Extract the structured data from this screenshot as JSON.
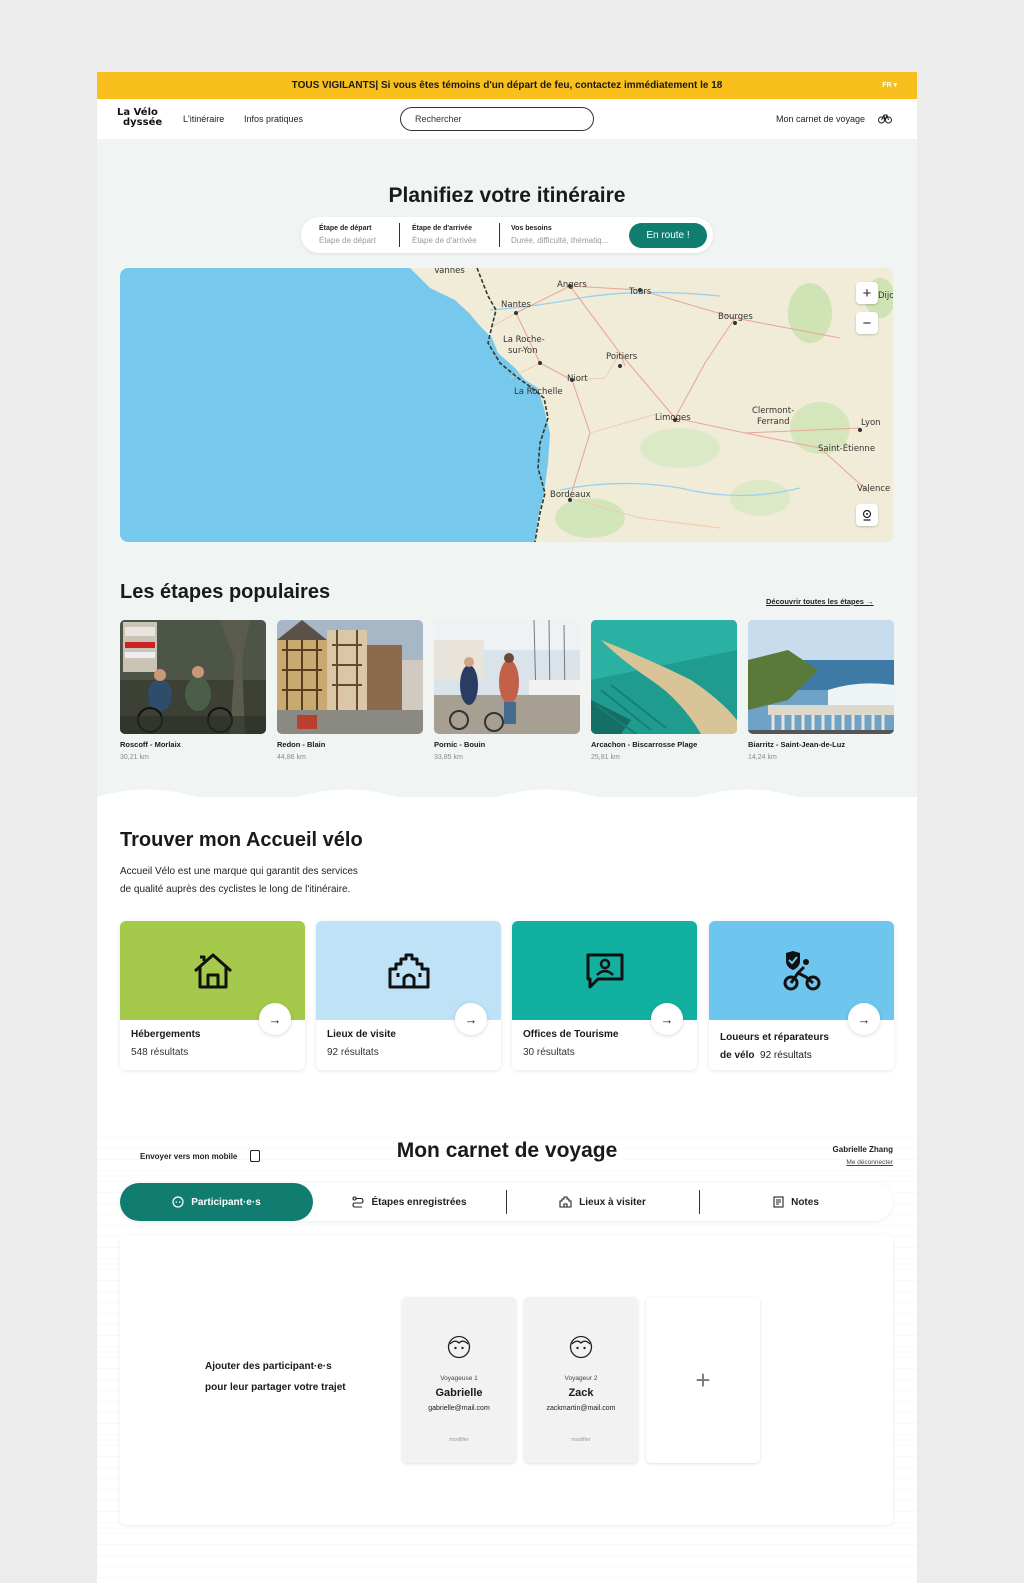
{
  "alert": {
    "message_bold": "TOUS VIGILANTS",
    "message": " | Si vous êtes témoins d'un départ de feu, contactez immédiatement le 18",
    "lang": "FR ▾"
  },
  "nav": {
    "logo_top": "La Vélo",
    "logo_bottom": "dyssée",
    "links": [
      "L'itinéraire",
      "Infos pratiques"
    ],
    "search_placeholder": "Rechercher",
    "carnet_link": "Mon carnet de voyage"
  },
  "planner": {
    "title": "Planifiez votre itinéraire",
    "fields": [
      {
        "label": "Étape de départ",
        "placeholder": "Étape de départ"
      },
      {
        "label": "Étape de d'arrivée",
        "placeholder": "Étape de d'arrivée"
      },
      {
        "label": "Vos besoins",
        "placeholder": "Durée, difficulté, thématiq..."
      }
    ],
    "button": "En route !"
  },
  "map": {
    "cities": [
      "Vannes",
      "Angers",
      "Tours",
      "Nantes",
      "Bourges",
      "La Roche-",
      "sur-Yon",
      "Poitiers",
      "Niort",
      "La Rochelle",
      "Limoges",
      "Clermont-",
      "Ferrand",
      "Lyon",
      "Saint-Étienne",
      "Valence",
      "Bordeaux",
      "Dijon"
    ],
    "zoom_in": "+",
    "zoom_out": "−"
  },
  "stages": {
    "title": "Les étapes populaires",
    "link": "Découvrir toutes les étapes →",
    "items": [
      {
        "name": "Roscoff - Morlaix",
        "distance": "30,21 km"
      },
      {
        "name": "Redon - Blain",
        "distance": "44,86 km"
      },
      {
        "name": "Pornic - Bouin",
        "distance": "33,85 km"
      },
      {
        "name": "Arcachon - Biscarrosse Plage",
        "distance": "25,81 km"
      },
      {
        "name": "Biarritz - Saint-Jean-de-Luz",
        "distance": "14,24 km"
      }
    ]
  },
  "accueil": {
    "title": "Trouver mon Accueil vélo",
    "desc_line1": "Accueil Vélo est une marque qui garantit des services",
    "desc_line2": "de qualité auprès des cyclistes le long de l'itinéraire.",
    "categories": [
      {
        "name": "Hébergements",
        "count": "548 résultats",
        "icon": "house-icon",
        "color": "#a5c94b"
      },
      {
        "name": "Lieux de visite",
        "count": "92 résultats",
        "icon": "castle-icon",
        "color": "#bfe2f6"
      },
      {
        "name": "Offices de Tourisme",
        "count": "30 résultats",
        "icon": "info-chat-icon",
        "color": "#12b0a0"
      },
      {
        "name_line1": "Loueurs et réparateurs",
        "name_line2": "de vélo",
        "count": "92 résultats",
        "icon": "bike-shield-icon",
        "color": "#6ec6ef"
      }
    ]
  },
  "carnet": {
    "send_mobile": "Envoyer vers mon mobile",
    "title": "Mon carnet de voyage",
    "user": "Gabrielle Zhang",
    "logout": "Me déconnecter",
    "tabs": [
      "Participant·e·s",
      "Étapes enregistrées",
      "Lieux à visiter",
      "Notes"
    ],
    "add_text_line1": "Ajouter des participant·e·s",
    "add_text_line2": "pour leur partager votre trajet",
    "participants": [
      {
        "role": "Voyageuse 1",
        "name": "Gabrielle",
        "email": "gabrielle@mail.com",
        "edit": "modifier"
      },
      {
        "role": "Voyageur 2",
        "name": "Zack",
        "email": "zackmartin@mail.com",
        "edit": "modifier"
      }
    ],
    "add_symbol": "+"
  },
  "colors": {
    "accent": "#117d71",
    "alert": "#f8bf1d",
    "sea": "#76c9ec",
    "land": "#f1ecd8"
  }
}
